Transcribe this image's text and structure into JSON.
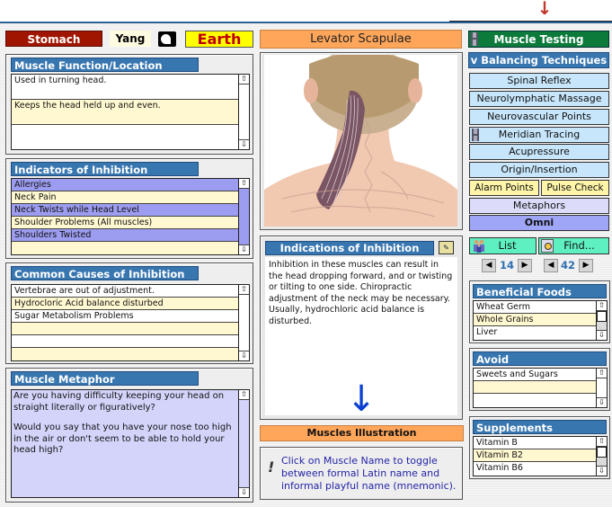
{
  "header": {
    "meridian": "Stomach",
    "polarity": "Yang",
    "element": "Earth",
    "muscle_name": "Levator Scapulae"
  },
  "muscle_function": {
    "title": "Muscle Function/Location",
    "rows": [
      "Used in turning head.",
      "Keeps the head held up and even.",
      ""
    ]
  },
  "indicators": {
    "title": "Indicators of Inhibition",
    "rows": [
      "Allergies",
      "Neck Pain",
      "Neck Twists while Head Level",
      "Shoulder Problems (All muscles)",
      "Shoulders Twisted",
      ""
    ]
  },
  "causes": {
    "title": "Common Causes of Inhibition",
    "rows": [
      "Vertebrae are out of adjustment.",
      "Hydrocloric Acid balance disturbed",
      "Sugar Metabolism Problems",
      "",
      "",
      ""
    ]
  },
  "metaphor": {
    "title": "Muscle Metaphor",
    "p1": "Are you having difficulty keeping your head on straight literally or figuratively?",
    "p2": "Would you say that you have your nose too high in the air or don't seem to be able to hold your head high?"
  },
  "indications": {
    "title": "Indications of Inhibition",
    "text": "Inhibition in these muscles can result in the head dropping forward, and or twisting or tilting to one side. Chiropractic adjustment of the neck may be necessary. Usually, hydrochloric acid balance is disturbed."
  },
  "illustration_button": "Muscles Illustration",
  "tip": "Click on Muscle Name to toggle between formal Latin name and informal playful name (mnemonic).",
  "right": {
    "muscle_testing": "Muscle Testing",
    "balancing_header": "v Balancing Techniques v",
    "techniques": [
      "Spinal Reflex",
      "Neurolymphatic Massage",
      "Neurovascular Points",
      "Meridian Tracing",
      "Acupressure",
      "Origin/Insertion"
    ],
    "alarm_points": "Alarm Points",
    "pulse_check": "Pulse Check",
    "metaphors": "Metaphors",
    "omni": "Omni",
    "list": "List",
    "find": "Find...",
    "pager1": "14",
    "pager2": "42"
  },
  "foods": {
    "title": "Beneficial Foods",
    "rows": [
      "Wheat Germ",
      "Whole Grains",
      "Liver"
    ]
  },
  "avoid": {
    "title": "Avoid",
    "rows": [
      "Sweets and Sugars",
      "",
      ""
    ]
  },
  "supplements": {
    "title": "Supplements",
    "rows": [
      "Vitamin B",
      "Vitamin B2",
      "Vitamin B6"
    ]
  },
  "icons": {
    "top_arrow": "↓",
    "down_arrow": "↓",
    "scroll_up": "⇧",
    "scroll_down": "⇩",
    "prev": "◀",
    "next": "▶",
    "tip": "!"
  }
}
